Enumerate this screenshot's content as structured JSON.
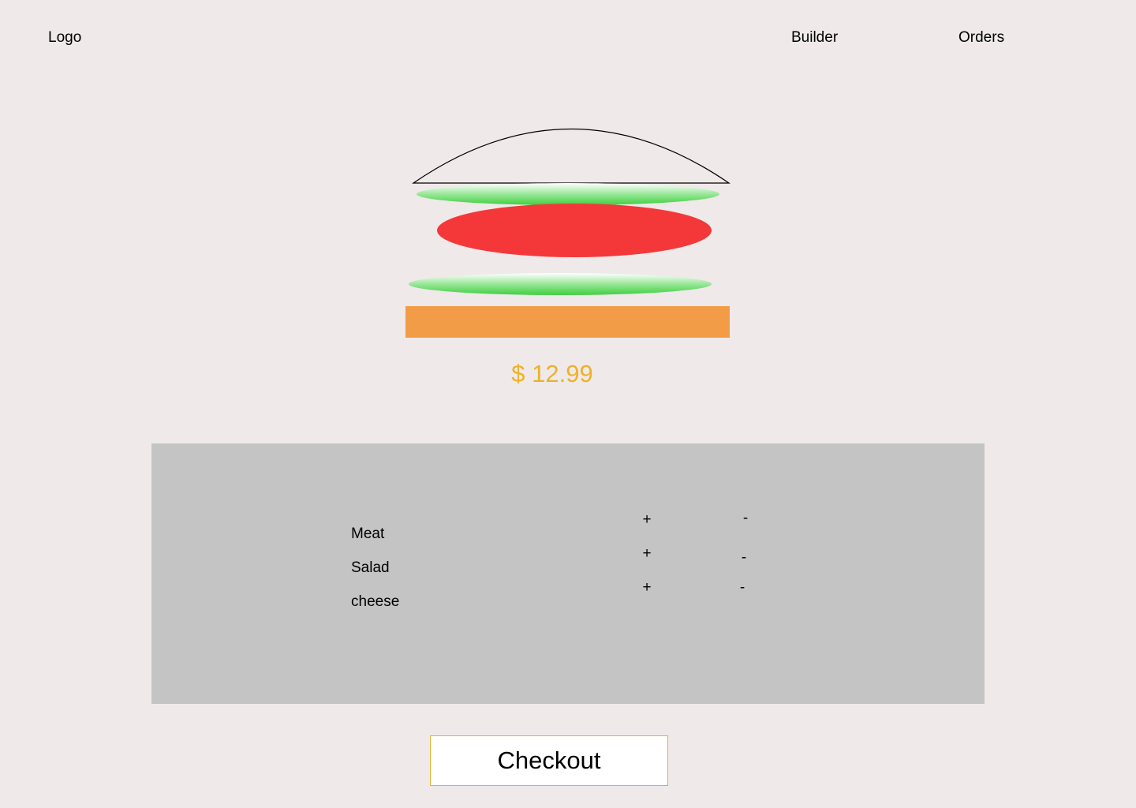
{
  "header": {
    "logo": "Logo",
    "nav": {
      "builder": "Builder",
      "orders": "Orders"
    }
  },
  "burger": {
    "layers": [
      "bun-top",
      "salad",
      "meat",
      "salad",
      "cheese"
    ],
    "colors": {
      "salad_edge": "#3fcf3f",
      "salad_center": "#ffffff",
      "meat": "#f4383a",
      "cheese": "#f39c47",
      "bun_outline": "#000000"
    }
  },
  "price": "$ 12.99",
  "ingredients": [
    {
      "label": "Meat",
      "add": "+",
      "remove": "-"
    },
    {
      "label": "Salad",
      "add": "+",
      "remove": "-"
    },
    {
      "label": "cheese",
      "add": "+",
      "remove": "-"
    }
  ],
  "checkout_label": "Checkout",
  "colors": {
    "background": "#efe9e9",
    "panel": "#c4c4c4",
    "price": "#edb12a",
    "checkout_border": "#e3b12e"
  }
}
